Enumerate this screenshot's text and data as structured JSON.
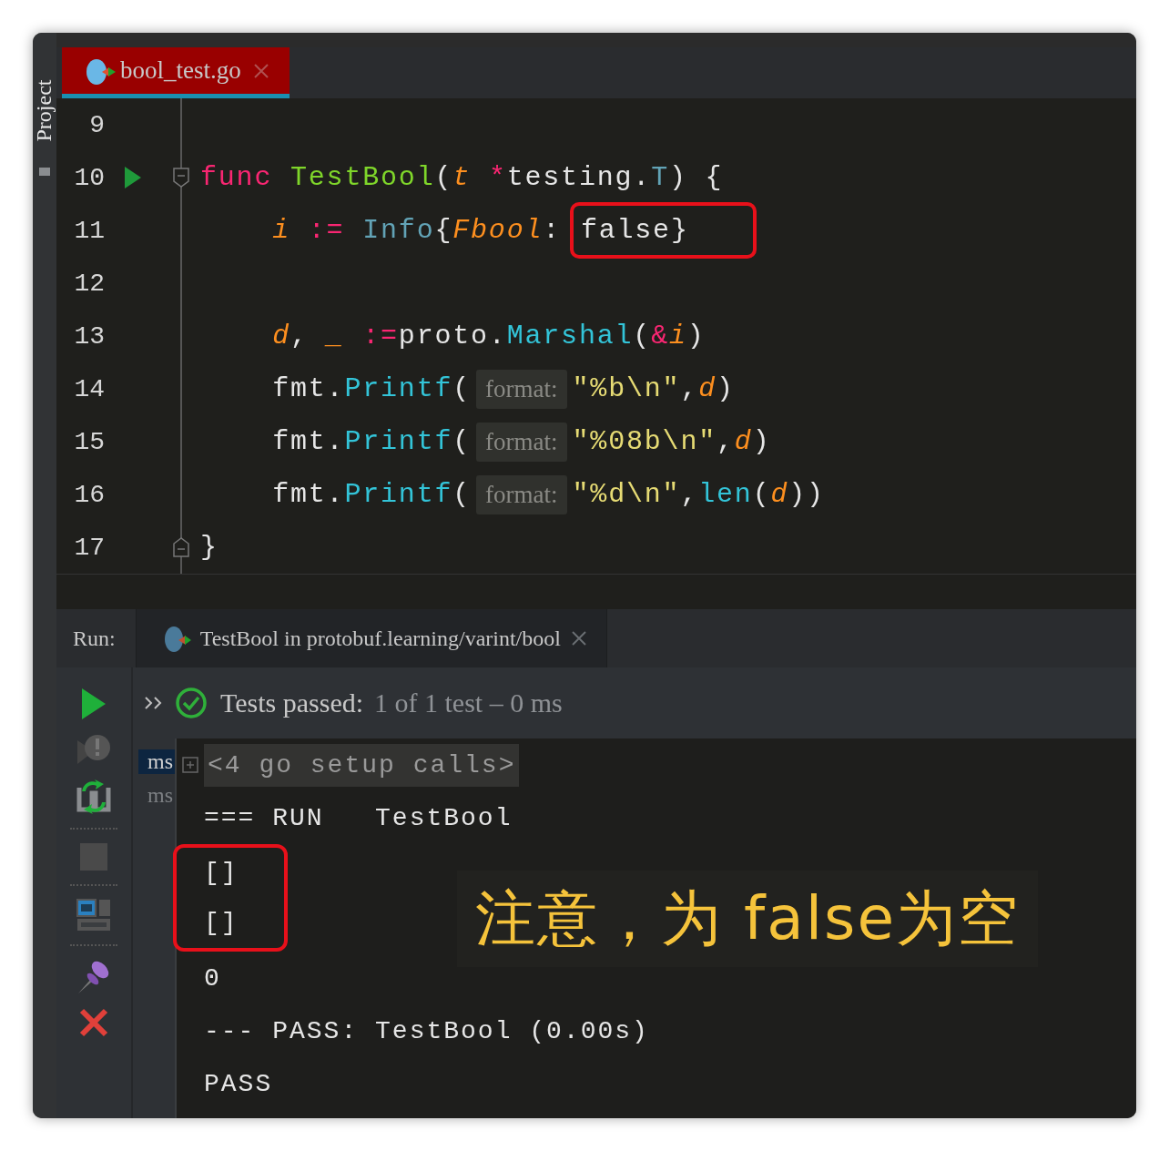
{
  "side_panel": {
    "label": "Project"
  },
  "editor": {
    "tab": {
      "label": "bool_test.go",
      "selected": true
    },
    "lines": [
      {
        "number": "9",
        "run_marker": false,
        "fold_start": false,
        "fold_end": false
      },
      {
        "number": "10",
        "run_marker": true,
        "fold_start": true,
        "fold_end": false,
        "tokens": [
          {
            "kind": "keyword",
            "text": "func "
          },
          {
            "kind": "function",
            "text": "TestBool"
          },
          {
            "kind": "plain",
            "text": "("
          },
          {
            "kind": "param",
            "text": "t "
          },
          {
            "kind": "operator",
            "text": "*"
          },
          {
            "kind": "plain",
            "text": "testing."
          },
          {
            "kind": "type",
            "text": "T"
          },
          {
            "kind": "plain",
            "text": ") {"
          }
        ]
      },
      {
        "number": "11",
        "run_marker": false,
        "fold_start": false,
        "fold_end": false,
        "tokens": [
          {
            "kind": "param",
            "text": "    i"
          },
          {
            "kind": "operator",
            "text": " := "
          },
          {
            "kind": "type",
            "text": "Info"
          },
          {
            "kind": "plain",
            "text": "{"
          },
          {
            "kind": "param",
            "text": "Fbool"
          },
          {
            "kind": "plain",
            "text": ": "
          },
          {
            "kind": "plain",
            "text": "false}",
            "highlighted": true
          }
        ]
      },
      {
        "number": "12",
        "run_marker": false,
        "fold_start": false,
        "fold_end": false
      },
      {
        "number": "13",
        "run_marker": false,
        "fold_start": false,
        "fold_end": false,
        "tokens": [
          {
            "kind": "param",
            "text": "    d"
          },
          {
            "kind": "plain",
            "text": ", "
          },
          {
            "kind": "param",
            "text": "_"
          },
          {
            "kind": "operator",
            "text": " :="
          },
          {
            "kind": "plain",
            "text": "proto."
          },
          {
            "kind": "method",
            "text": "Marshal"
          },
          {
            "kind": "plain",
            "text": "("
          },
          {
            "kind": "operator",
            "text": "&"
          },
          {
            "kind": "param",
            "text": "i"
          },
          {
            "kind": "plain",
            "text": ")"
          }
        ]
      },
      {
        "number": "14",
        "run_marker": false,
        "fold_start": false,
        "fold_end": false,
        "tokens": [
          {
            "kind": "plain",
            "text": "    fmt."
          },
          {
            "kind": "method",
            "text": "Printf"
          },
          {
            "kind": "plain",
            "text": "("
          },
          {
            "kind": "hint",
            "text": "format:"
          },
          {
            "kind": "string",
            "text": "\"%b\\n\""
          },
          {
            "kind": "plain",
            "text": ","
          },
          {
            "kind": "param",
            "text": "d"
          },
          {
            "kind": "plain",
            "text": ")"
          }
        ]
      },
      {
        "number": "15",
        "run_marker": false,
        "fold_start": false,
        "fold_end": false,
        "tokens": [
          {
            "kind": "plain",
            "text": "    fmt."
          },
          {
            "kind": "method",
            "text": "Printf"
          },
          {
            "kind": "plain",
            "text": "("
          },
          {
            "kind": "hint",
            "text": "format:"
          },
          {
            "kind": "string",
            "text": "\"%08b\\n\""
          },
          {
            "kind": "plain",
            "text": ","
          },
          {
            "kind": "param",
            "text": "d"
          },
          {
            "kind": "plain",
            "text": ")"
          }
        ]
      },
      {
        "number": "16",
        "run_marker": false,
        "fold_start": false,
        "fold_end": false,
        "tokens": [
          {
            "kind": "plain",
            "text": "    fmt."
          },
          {
            "kind": "method",
            "text": "Printf"
          },
          {
            "kind": "plain",
            "text": "("
          },
          {
            "kind": "hint",
            "text": "format:"
          },
          {
            "kind": "string",
            "text": "\"%d\\n\""
          },
          {
            "kind": "plain",
            "text": ","
          },
          {
            "kind": "method",
            "text": "len"
          },
          {
            "kind": "plain",
            "text": "("
          },
          {
            "kind": "param",
            "text": "d"
          },
          {
            "kind": "plain",
            "text": "))"
          }
        ]
      },
      {
        "number": "17",
        "run_marker": false,
        "fold_start": false,
        "fold_end": true,
        "tokens": [
          {
            "kind": "plain",
            "text": "}"
          }
        ]
      }
    ]
  },
  "run_panel": {
    "label": "Run:",
    "tab": {
      "label": "TestBool in protobuf.learning/varint/bool",
      "selected": true
    },
    "status": {
      "title": "Tests passed:",
      "detail": "1 of 1 test – 0 ms"
    },
    "tree_items": [
      {
        "text": "ms",
        "selected": true
      },
      {
        "text": "ms",
        "selected": false
      }
    ],
    "console": {
      "setup_calls": "<4 go setup calls>",
      "lines": [
        {
          "text": "=== RUN   TestBool",
          "highlighted": false
        },
        {
          "text": "[]",
          "highlighted": true
        },
        {
          "text": "[]",
          "highlighted": true
        },
        {
          "text": "0",
          "highlighted": false
        },
        {
          "text": "--- PASS: TestBool (0.00s)",
          "highlighted": false
        },
        {
          "text": "PASS",
          "highlighted": false
        }
      ]
    }
  },
  "annotation": {
    "text": "注意，为 false为空"
  }
}
